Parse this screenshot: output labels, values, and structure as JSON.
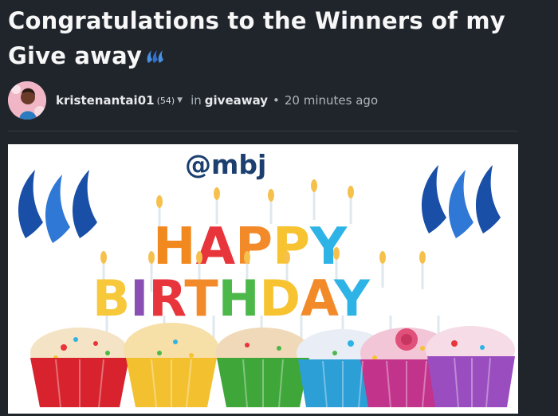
{
  "post": {
    "title": "Congratulations to the Winners of my Give away",
    "author": "kristenantai01",
    "reputation": "(54)",
    "in_label": "in",
    "category": "giveaway",
    "separator": "•",
    "timestamp": "20 minutes ago"
  },
  "image": {
    "tag_text": "@mbj",
    "line1": "HAPPY",
    "line2": "BIRTHDAY",
    "icon": "steem-logo-icon"
  },
  "colors": {
    "background": "#1f252b",
    "steem_blue": "#1a56b0",
    "title": "#f7f7f7",
    "meta": "#aeb4bb"
  }
}
